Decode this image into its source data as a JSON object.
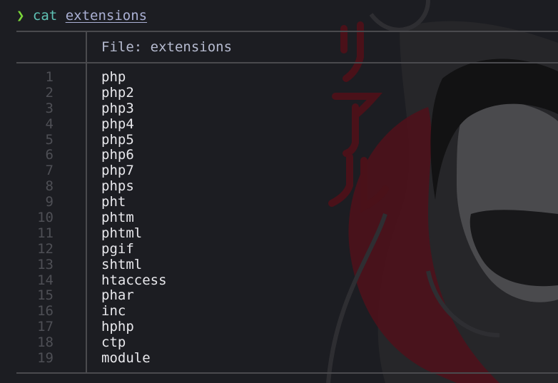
{
  "prompt": {
    "symbol": "❯",
    "command": "cat",
    "argument": "extensions"
  },
  "file": {
    "header": "File: extensions"
  },
  "lines": [
    {
      "n": "1",
      "text": "php"
    },
    {
      "n": "2",
      "text": "php2"
    },
    {
      "n": "3",
      "text": "php3"
    },
    {
      "n": "4",
      "text": "php4"
    },
    {
      "n": "5",
      "text": "php5"
    },
    {
      "n": "6",
      "text": "php6"
    },
    {
      "n": "7",
      "text": "php7"
    },
    {
      "n": "8",
      "text": "phps"
    },
    {
      "n": "9",
      "text": "pht"
    },
    {
      "n": "10",
      "text": "phtm"
    },
    {
      "n": "11",
      "text": "phtml"
    },
    {
      "n": "12",
      "text": "pgif"
    },
    {
      "n": "13",
      "text": "shtml"
    },
    {
      "n": "14",
      "text": "htaccess"
    },
    {
      "n": "15",
      "text": "phar"
    },
    {
      "n": "16",
      "text": "inc"
    },
    {
      "n": "17",
      "text": "hphp"
    },
    {
      "n": "18",
      "text": "ctp"
    },
    {
      "n": "19",
      "text": "module"
    }
  ],
  "colors": {
    "background": "#1c1d22",
    "prompt_arrow": "#7bd63a",
    "command": "#5fc3b6",
    "argument": "#aab0d4",
    "line_numbers": "#4e4f55",
    "content": "#e8e8ec",
    "wallpaper_accent": "#5a1620"
  }
}
